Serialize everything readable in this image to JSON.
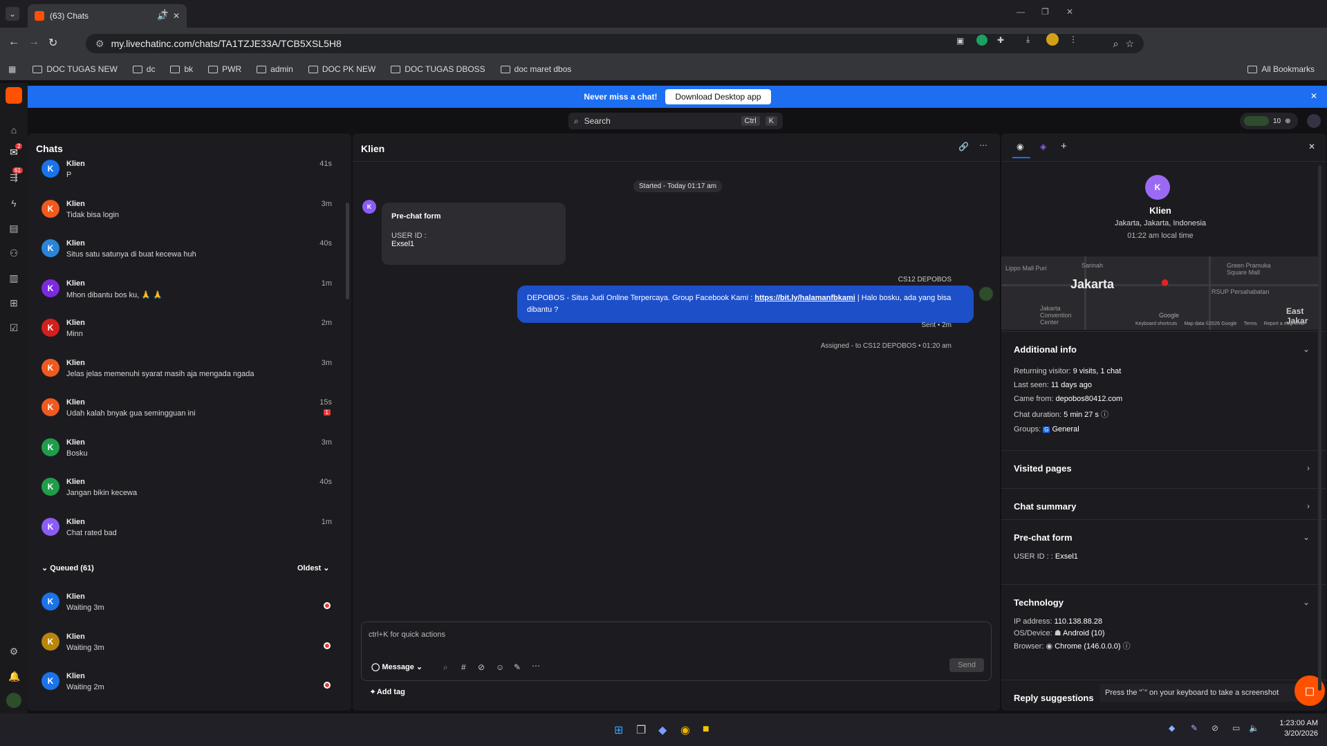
{
  "browser": {
    "tab_title": "(63) Chats",
    "url": "my.livechatinc.com/chats/TA1TZJE33A/TCB5XSL5H8",
    "bookmarks": [
      "DOC TUGAS NEW",
      "dc",
      "bk",
      "PWR",
      "admin",
      "DOC PK NEW",
      "DOC TUGAS DBOSS",
      "doc maret dbos"
    ],
    "all_bookmarks": "All Bookmarks"
  },
  "banner": {
    "text": "Never miss a chat!",
    "button": "Download Desktop app"
  },
  "search": {
    "placeholder": "Search",
    "kbd1": "Ctrl",
    "kbd2": "K"
  },
  "top_right": {
    "count": "10"
  },
  "nav": {
    "badge_chats": "2",
    "badge_queue": "61"
  },
  "chatlist": {
    "title": "Chats",
    "rows": [
      {
        "name": "Klien",
        "msg": "P",
        "time": "41s",
        "color": "#1a73e8"
      },
      {
        "name": "Klien",
        "msg": "Tidak bisa login",
        "time": "3m",
        "color": "#f05a1e"
      },
      {
        "name": "Klien",
        "msg": "Situs satu satunya di buat kecewa huh",
        "time": "40s",
        "color": "#2a84d8"
      },
      {
        "name": "Klien",
        "msg": "Mhon dibantu bos ku, 🙏 🙏",
        "time": "1m",
        "color": "#7b2ae0"
      },
      {
        "name": "Klien",
        "msg": "Minn",
        "time": "2m",
        "color": "#d41f1f"
      },
      {
        "name": "Klien",
        "msg": "Jelas jelas memenuhi syarat masih aja mengada ngada",
        "time": "3m",
        "color": "#f05a1e"
      },
      {
        "name": "Klien",
        "msg": "Udah kalah bnyak gua semingguan ini",
        "time": "15s",
        "color": "#f05a1e"
      },
      {
        "name": "Klien",
        "msg": "Bosku",
        "time": "3m",
        "color": "#1f9d4a"
      },
      {
        "name": "Klien",
        "msg": "Jangan bikin kecewa",
        "time": "40s",
        "color": "#1f9d4a"
      },
      {
        "name": "Klien",
        "msg": "Chat rated bad",
        "time": "1m",
        "color": "#8b5cf6"
      }
    ],
    "queued_label": "Queued (61)",
    "sort_label": "Oldest",
    "queued": [
      {
        "name": "Klien",
        "msg": "Waiting 3m",
        "color": "#1a73e8"
      },
      {
        "name": "Klien",
        "msg": "Waiting 3m",
        "color": "#b8860b"
      },
      {
        "name": "Klien",
        "msg": "Waiting 2m",
        "color": "#1a73e8"
      }
    ],
    "unread_badge": "1"
  },
  "chat": {
    "title": "Klien",
    "started": "Started - Today 01:17 am",
    "prechat_title": "Pre-chat form",
    "prechat_label": "USER ID :",
    "prechat_value": "Exsel1",
    "agent": "CS12 DEPOBOS",
    "msg_prefix": "DEPOBOS - Situs Judi Online Terpercaya. Group Facebook Kami : ",
    "msg_link": "https://bit.ly/halamanfbkami",
    "msg_suffix": " | Halo bosku, ada yang bisa dibantu ?",
    "sent": "Sent • 2m",
    "assigned": "Assigned - to CS12 DEPOBOS • 01:20 am",
    "input_placeholder": "ctrl+K for quick actions",
    "message_mode": "Message",
    "send": "Send",
    "add_tag": "Add tag"
  },
  "details": {
    "name": "Klien",
    "location": "Jakarta, Jakarta, Indonesia",
    "local_time": "01:22 am local time",
    "map_city": "Jakarta",
    "map_labels": [
      "Lippo Mall Puri",
      "Sarinah",
      "Green Pramuka Square Mall",
      "RSUP Persahabatan",
      "Jakarta Convention Center",
      "East Jakar",
      "Google"
    ],
    "map_footer": [
      "Keyboard shortcuts",
      "Map data ©2026 Google",
      "Terms",
      "Report a map error"
    ],
    "additional_info": "Additional info",
    "returning_label": "Returning visitor:",
    "returning_value": "9 visits, 1 chat",
    "last_seen_label": "Last seen:",
    "last_seen_value": "11 days ago",
    "came_from_label": "Came from:",
    "came_from_value": "depobos80412.com",
    "duration_label": "Chat duration:",
    "duration_value": "5 min 27 s",
    "groups_label": "Groups:",
    "groups_value": "General",
    "visited_pages": "Visited pages",
    "chat_summary": "Chat summary",
    "prechat_form": "Pre-chat form",
    "prechat_label": "USER ID : :",
    "prechat_value": "Exsel1",
    "technology": "Technology",
    "ip_label": "IP address:",
    "ip_value": "110.138.88.28",
    "os_label": "OS/Device:",
    "os_value": "Android (10)",
    "browser_label": "Browser:",
    "browser_value": "Chrome (146.0.0.0)",
    "reply_suggestions": "Reply suggestions",
    "screenshot_tip": "Press the \"`\" on your keyboard to take a screenshot"
  },
  "taskbar": {
    "time": "1:23:00 AM",
    "date": "3/20/2026"
  }
}
